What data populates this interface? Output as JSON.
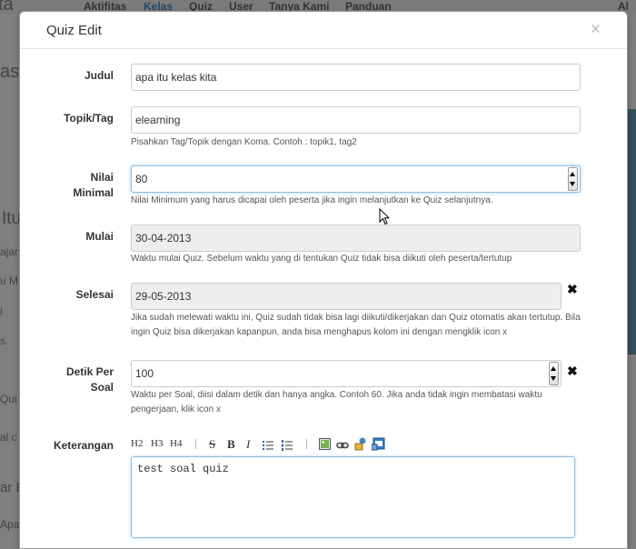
{
  "background": {
    "brand": "ta",
    "nav": [
      "Aktifitas",
      "Kelas",
      "Quiz",
      "User",
      "Tanya Kami",
      "Panduan"
    ],
    "nav_right": "Al",
    "misc": [
      "ask",
      "Itu",
      "ajar",
      "u M",
      "l",
      "s",
      "Qui",
      "al c",
      "ar R",
      "Apa"
    ]
  },
  "modal": {
    "title": "Quiz Edit",
    "close": "×"
  },
  "form": {
    "judul": {
      "label": "Judul",
      "value": "apa itu kelas kita"
    },
    "topik": {
      "label": "Topik/Tag",
      "value": "elearning",
      "help": "Pisahkan Tag/Topik dengan Koma. Contoh : topik1, tag2"
    },
    "nilai": {
      "label_1": "Nilai",
      "label_2": "Minimal",
      "value": "80",
      "help": "Nilai Minimum yang harus dicapai oleh peserta jika ingin melanjutkan ke Quiz selanjutnya."
    },
    "mulai": {
      "label": "Mulai",
      "value": "30-04-2013",
      "help": "Waktu mulai Quiz. Sebelum waktu yang di tentukan Quiz tidak bisa diikuti oleh peserta/tertutup"
    },
    "selesai": {
      "label": "Selesai",
      "value": "29-05-2013",
      "help_1": "Jika sudah melewati waktu ini, Quiz sudah tidak bisa lagi diikuti/dikerjakan dan Quiz otomatis akan tertutup. Bila",
      "help_2": "ingin Quiz bisa dikerjakan kapanpun, anda bisa menghapus kolom ini dengan mengklik icon x",
      "clear": "✖"
    },
    "detik": {
      "label_1": "Detik Per",
      "label_2": "Soal",
      "value": "100",
      "help_1": "Waktu per Soal, diisi dalam detik dan hanya angka. Contoh 60. Jika anda tidak ingin membatasi waktu",
      "help_2": "pengerjaan, klik icon x",
      "clear": "✖"
    },
    "keterangan": {
      "label": "Keterangan",
      "toolbar": {
        "h2": "H2",
        "h3": "H3",
        "h4": "H4",
        "strike": "S",
        "bold": "B",
        "italic": "I"
      },
      "value": "test soal quiz"
    }
  }
}
